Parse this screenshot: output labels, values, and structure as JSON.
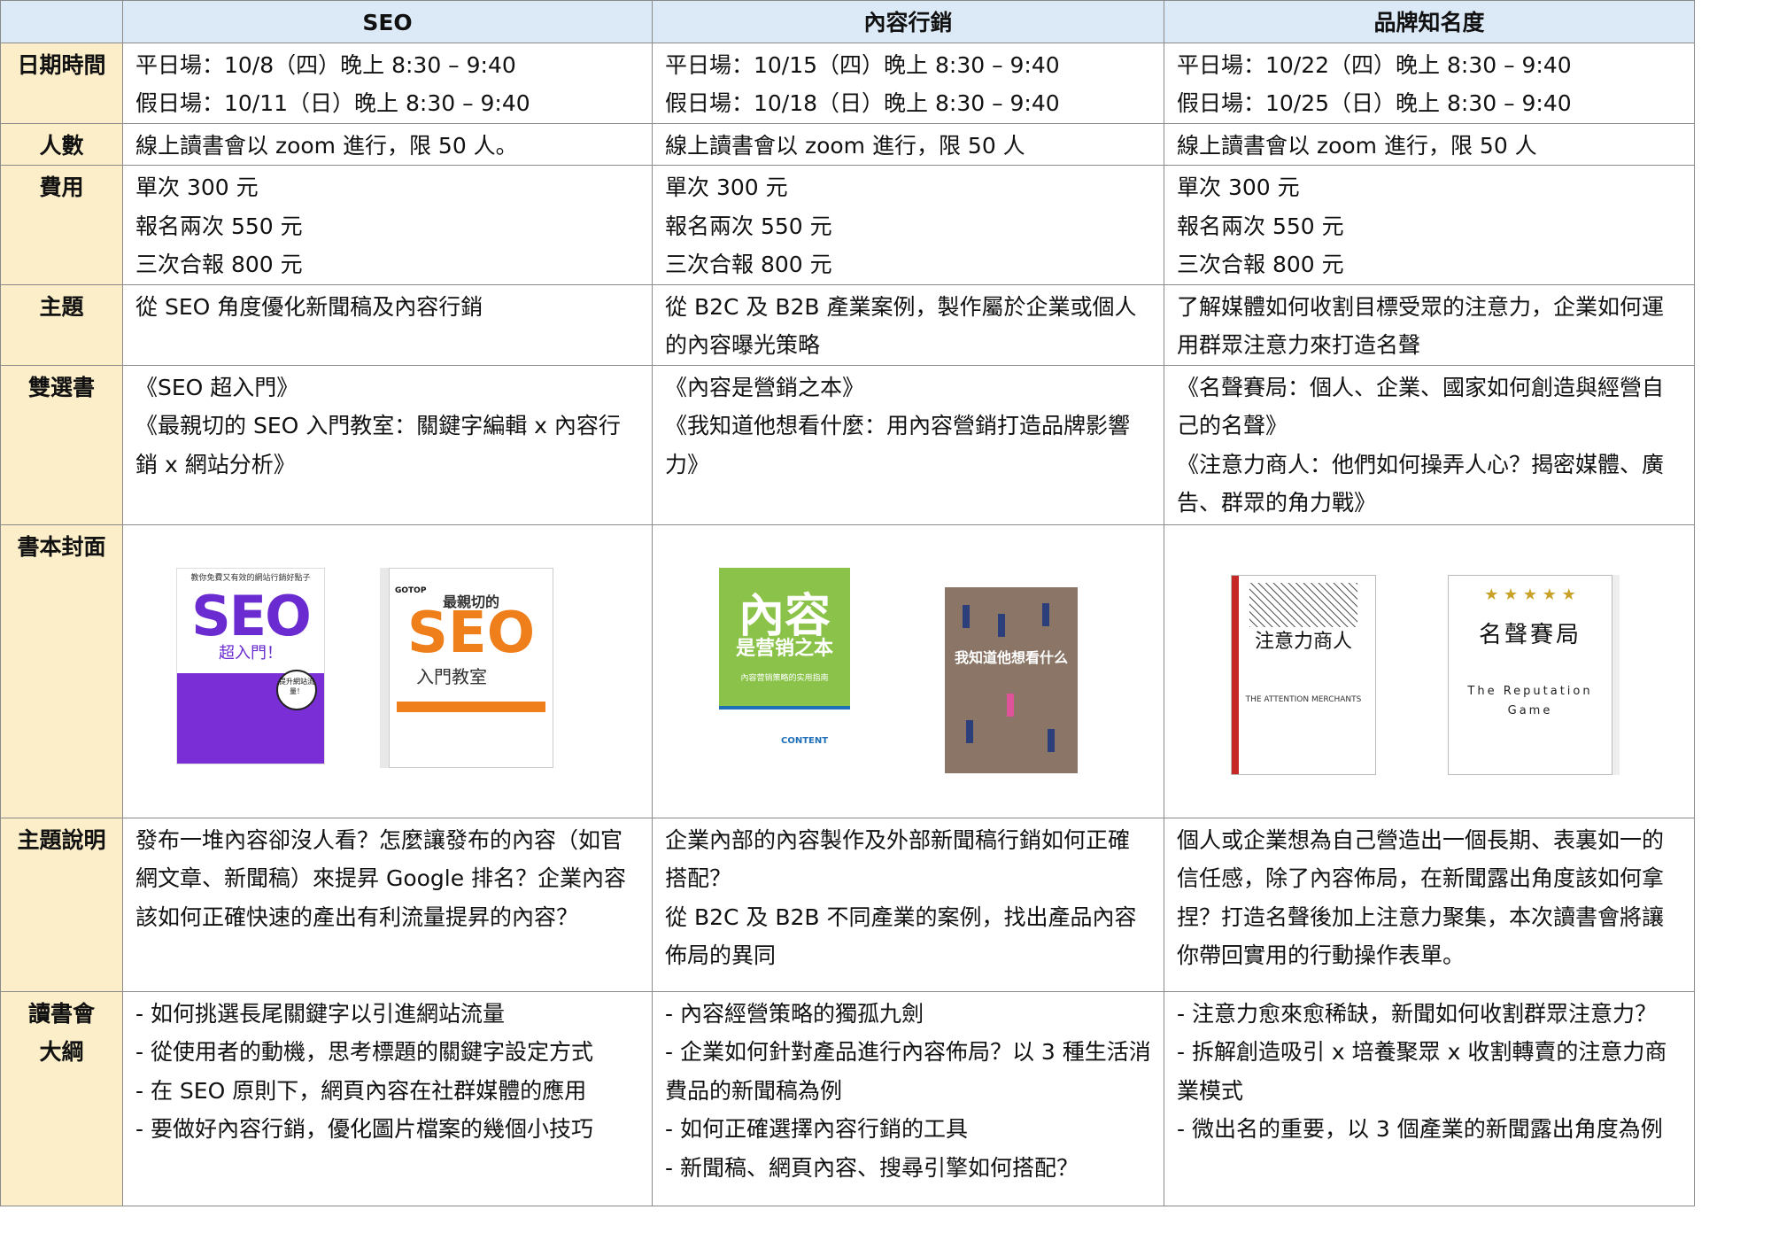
{
  "columns": [
    "SEO",
    "內容行銷",
    "品牌知名度"
  ],
  "rows": {
    "date": {
      "label": "日期時間",
      "cells": [
        [
          "平日場：10/8（四）晚上 8:30 – 9:40",
          "假日場：10/11（日）晚上 8:30 – 9:40"
        ],
        [
          "平日場：10/15（四）晚上 8:30 – 9:40",
          "假日場：10/18（日）晚上 8:30 – 9:40"
        ],
        [
          "平日場：10/22（四）晚上 8:30 – 9:40",
          "假日場：10/25（日）晚上 8:30 – 9:40"
        ]
      ]
    },
    "people": {
      "label": "人數",
      "cells": [
        "線上讀書會以 zoom 進行，限 50 人。",
        "線上讀書會以 zoom 進行，限 50 人",
        "線上讀書會以 zoom 進行，限 50 人"
      ]
    },
    "fee": {
      "label": "費用",
      "cells": [
        [
          "單次 300 元",
          "報名兩次 550 元",
          "三次合報 800 元"
        ],
        [
          "單次 300 元",
          "報名兩次 550 元",
          "三次合報 800 元"
        ],
        [
          "單次 300 元",
          "報名兩次 550 元",
          "三次合報 800 元"
        ]
      ]
    },
    "topic": {
      "label": "主題",
      "cells": [
        "從 SEO 角度優化新聞稿及內容行銷",
        "從 B2C 及 B2B 產業案例，製作屬於企業或個人的內容曝光策略",
        "了解媒體如何收割目標受眾的注意力，企業如何運用群眾注意力來打造名聲"
      ]
    },
    "books": {
      "label": "雙選書",
      "cells": [
        [
          " 《SEO 超入門》",
          " 《最親切的 SEO 入門教室：關鍵字編輯 x 內容行銷 x 網站分析》"
        ],
        [
          "《內容是營銷之本》",
          " 《我知道他想看什麼：用內容營銷打造品牌影響力》"
        ],
        [
          "《名聲賽局：個人、企業、國家如何創造與經營自己的名聲》",
          "《注意力商人：他們如何操弄人心？揭密媒體、廣告、群眾的角力戰》"
        ]
      ]
    },
    "covers": {
      "label": "書本封面",
      "seo": {
        "book1_top": "教你免費又有效的網站行銷好點子",
        "book1_title": "SEO",
        "book1_sub": "超入門！",
        "book1_sticker": "提升網站流量！",
        "book2_logo": "GOTOP",
        "book2_title": "SEO",
        "book2_sub": "入門教室",
        "book2_head": "最親切的"
      },
      "content": {
        "book3_title": "內容",
        "book3_sub": "是营销之本",
        "book3_sub2": "內容营销策略的实用指南",
        "book3_panel": "CONTENT",
        "book4_title": "我知道他想看什么"
      },
      "brand": {
        "book5_title": "注意力商人",
        "book5_sub": "THE ATTENTION MERCHANTS",
        "book6_stars": "★ ★ ★ ★ ★",
        "book6_title": "名聲賽局",
        "book6_eng": "The Reputation Game"
      }
    },
    "desc": {
      "label": "主題說明",
      "cells": [
        "發布一堆內容卻沒人看？怎麼讓發布的內容（如官網文章、新聞稿）來提昇 Google 排名？企業內容該如何正確快速的產出有利流量提昇的內容？",
        [
          "企業內部的內容製作及外部新聞稿行銷如何正確搭配？",
          "從 B2C 及 B2B 不同產業的案例，找出產品內容佈局的異同"
        ],
        "個人或企業想為自己營造出一個長期、表裏如一的信任感，除了內容佈局，在新聞露出角度該如何拿捏？打造名聲後加上注意力聚集，本次讀書會將讓你帶回實用的行動操作表單。"
      ]
    },
    "outline": {
      "label_1": "讀書會",
      "label_2": "大綱",
      "cells": [
        [
          "- 如何挑選長尾關鍵字以引進網站流量",
          "- 從使用者的動機，思考標題的關鍵字設定方式",
          "- 在 SEO 原則下，網頁內容在社群媒體的應用",
          "- 要做好內容行銷，優化圖片檔案的幾個小技巧"
        ],
        [
          "- 內容經營策略的獨孤九劍",
          "- 企業如何針對產品進行內容佈局？以 3 種生活消費品的新聞稿為例",
          "- 如何正確選擇內容行銷的工具",
          "- 新聞稿、網頁內容、搜尋引擎如何搭配？"
        ],
        [
          "- 注意力愈來愈稀缺，新聞如何收割群眾注意力？",
          "- 拆解創造吸引 x  培養聚眾 x 收割轉賣的注意力商業模式",
          "- 微出名的重要，以 3 個產業的新聞露出角度為例"
        ]
      ]
    }
  }
}
